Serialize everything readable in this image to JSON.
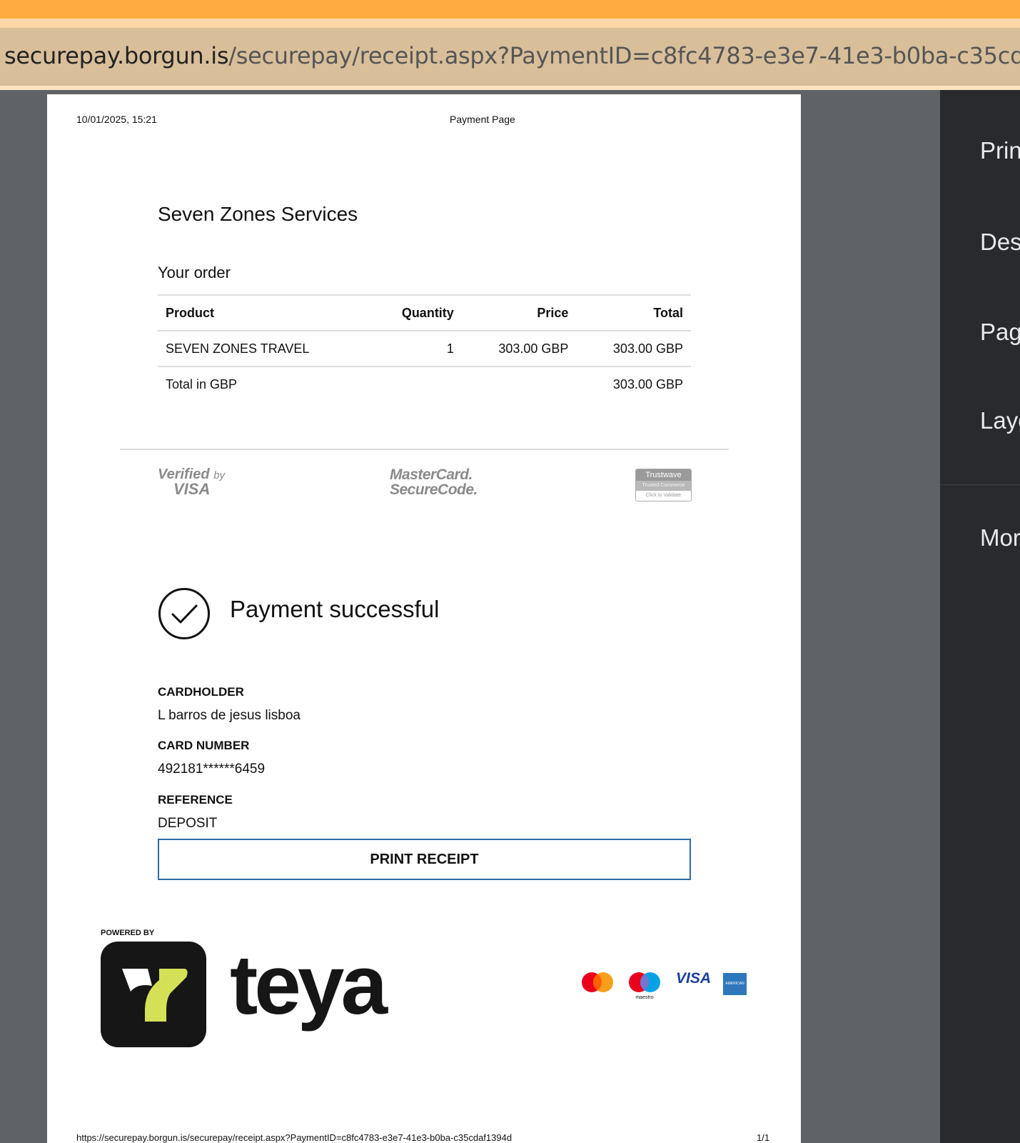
{
  "browser": {
    "url_host": "securepay.borgun.is",
    "url_path": "/securepay/receipt.aspx?PaymentID=c8fc4783-e3e7-41e3-b0ba-c35cdaf1394d"
  },
  "print_header": {
    "datetime": "10/01/2025, 15:21",
    "title": "Payment Page"
  },
  "merchant_name": "Seven Zones Services",
  "order": {
    "heading": "Your order",
    "columns": {
      "product": "Product",
      "quantity": "Quantity",
      "price": "Price",
      "total": "Total"
    },
    "items": [
      {
        "product": "SEVEN ZONES TRAVEL",
        "quantity": "1",
        "price": "303.00 GBP",
        "total": "303.00 GBP"
      }
    ],
    "total_label": "Total in GBP",
    "total_value": "303.00 GBP"
  },
  "security_logos": {
    "verified_by": "Verified",
    "by": "by",
    "visa": "VISA",
    "mastercard": "MasterCard.",
    "securecode": "SecureCode.",
    "trustwave": "Trustwave",
    "trusted_commerce": "Trusted Commerce",
    "click_to_validate": "Click to Validate"
  },
  "status": {
    "message": "Payment successful",
    "icon": "checkmark-circle-icon"
  },
  "details": {
    "cardholder_label": "CARDHOLDER",
    "cardholder_value": "L barros de jesus lisboa",
    "card_number_label": "CARD NUMBER",
    "card_number_value": "492181******6459",
    "reference_label": "REFERENCE",
    "reference_value": "DEPOSIT"
  },
  "print_button_label": "PRINT RECEIPT",
  "powered_by": {
    "label": "POWERED BY",
    "brand": "teya"
  },
  "card_brands": {
    "maestro": "maestro",
    "visa": "VISA",
    "amex": "AMERICAN EXPRESS"
  },
  "print_footer": {
    "url": "https://securepay.borgun.is/securepay/receipt.aspx?PaymentID=c8fc4783-e3e7-41e3-b0ba-c35cdaf1394d",
    "page": "1/1"
  },
  "print_settings": {
    "items": [
      "Print",
      "Dest",
      "Page",
      "Layo",
      "Mor"
    ]
  },
  "colors": {
    "accent_orange": "#ffab40",
    "button_border": "#2f6aa3",
    "teya_lime": "#d4e157"
  }
}
